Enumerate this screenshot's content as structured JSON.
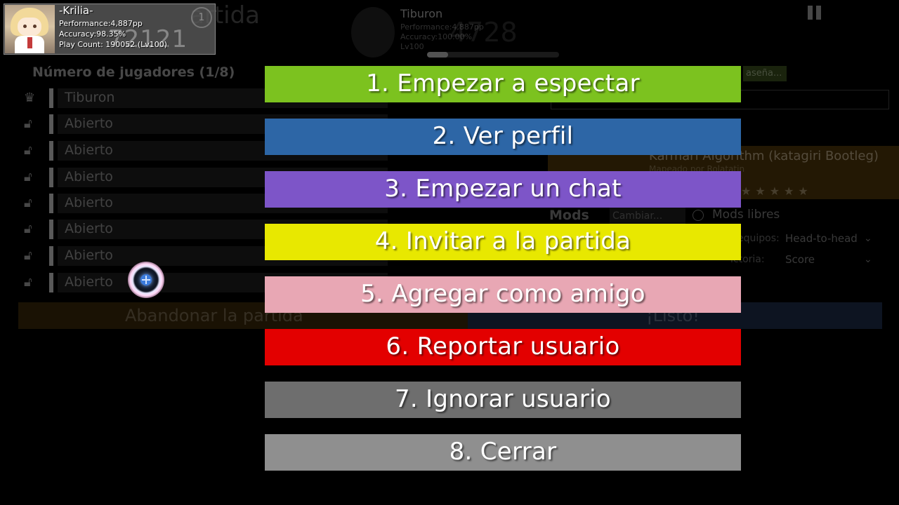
{
  "user_card": {
    "name": "-Krilia-",
    "performance": "Performance:4,887pp",
    "accuracy": "Accuracy:98.35%",
    "play_count": "Play Count: 190052 (Lv100)",
    "rank": "72121",
    "rank_badge": "1"
  },
  "background": {
    "title_fragment": "artida",
    "host": {
      "name": "Tiburon",
      "performance": "Performance:4,887pp",
      "accuracy": "Accuracy:100.00%",
      "level": "Lv100",
      "rank": "4728"
    },
    "players_header": "Número de jugadores (1/8)",
    "slots": [
      {
        "label": "Tiburon",
        "icon": "crown-icon"
      },
      {
        "label": "Abierto",
        "icon": "unlock-icon"
      },
      {
        "label": "Abierto",
        "icon": "unlock-icon"
      },
      {
        "label": "Abierto",
        "icon": "unlock-icon"
      },
      {
        "label": "Abierto",
        "icon": "unlock-icon"
      },
      {
        "label": "Abierto",
        "icon": "unlock-icon"
      },
      {
        "label": "Abierto",
        "icon": "unlock-icon"
      },
      {
        "label": "Abierto",
        "icon": "unlock-icon"
      }
    ],
    "leave_label": "Abandonar la partida",
    "ready_label": "¡Listo!",
    "password_badge": "aseña...",
    "beatmap_title": "Karmari Algorithm (katagiri Bootleg)",
    "beatmap_subtitle": "Mapeado por Rolatatin",
    "mods_label": "Mods",
    "mods_change": "Cambiar...",
    "free_mods": "Mods libres",
    "team_mode_label": "equipos:",
    "team_mode_value": "Head-to-head",
    "win_condition_label": "ictoria:",
    "win_condition_value": "Score"
  },
  "menu": {
    "items": [
      {
        "label": "1. Empezar a espectar",
        "color": "#7cc21f"
      },
      {
        "label": "2. Ver perfil",
        "color": "#2d66a6"
      },
      {
        "label": "3. Empezar un chat",
        "color": "#7d55c8"
      },
      {
        "label": "4. Invitar a la partida",
        "color": "#e8e800"
      },
      {
        "label": "5. Agregar como amigo",
        "color": "#e8a7b4"
      },
      {
        "label": "6. Reportar usuario",
        "color": "#e30000"
      },
      {
        "label": "7. Ignorar usuario",
        "color": "#6e6e6e"
      },
      {
        "label": "8. Cerrar",
        "color": "#8f8f8f"
      }
    ]
  }
}
